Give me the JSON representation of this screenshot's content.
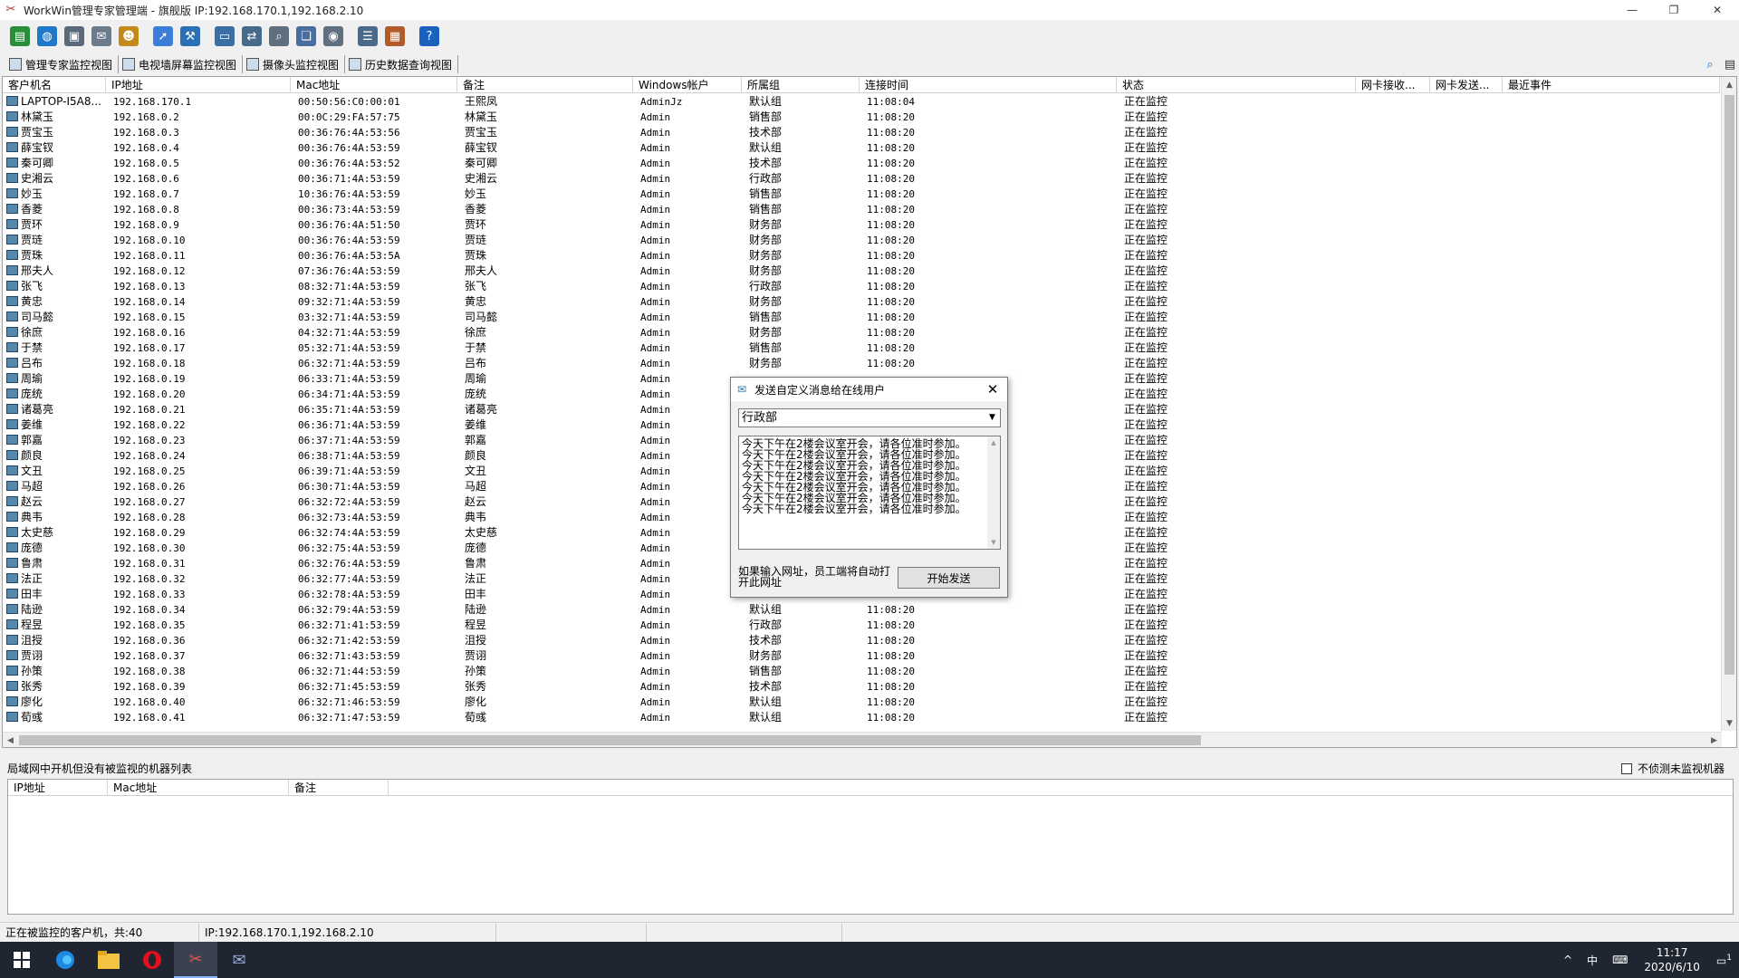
{
  "window": {
    "title": "WorkWin管理专家管理端 - 旗舰版 IP:192.168.170.1,192.168.2.10",
    "minimize": "—",
    "restore": "❐",
    "close": "✕"
  },
  "toolbar": {
    "buttons": [
      {
        "icon": "database-icon",
        "glyph": "▤",
        "color": "#2a8f3a"
      },
      {
        "icon": "globe-icon",
        "glyph": "◍",
        "color": "#1f78c8"
      },
      {
        "icon": "monitor-settings-icon",
        "glyph": "▣",
        "color": "#5a6a7a"
      },
      {
        "icon": "mail-icon",
        "glyph": "✉",
        "color": "#6b7b8c"
      },
      {
        "icon": "users-icon",
        "glyph": "☻",
        "color": "#c28a1a"
      },
      {
        "icon": "sep"
      },
      {
        "icon": "folder-send-icon",
        "glyph": "➚",
        "color": "#3b7dd8"
      },
      {
        "icon": "tools-icon",
        "glyph": "⚒",
        "color": "#2b70b5"
      },
      {
        "icon": "sep"
      },
      {
        "icon": "screen-icon",
        "glyph": "▭",
        "color": "#3a6ea5"
      },
      {
        "icon": "network-icon",
        "glyph": "⇄",
        "color": "#486a8a"
      },
      {
        "icon": "search-file-icon",
        "glyph": "⌕",
        "color": "#5f6f80"
      },
      {
        "icon": "windows-icon",
        "glyph": "❏",
        "color": "#4a6f9f"
      },
      {
        "icon": "camera-icon",
        "glyph": "◉",
        "color": "#607080"
      },
      {
        "icon": "sep"
      },
      {
        "icon": "list-icon",
        "glyph": "☰",
        "color": "#4b6a8b"
      },
      {
        "icon": "report-icon",
        "glyph": "▦",
        "color": "#b35a2a"
      },
      {
        "icon": "sep"
      },
      {
        "icon": "help-icon",
        "glyph": "?",
        "color": "#1b62c0"
      }
    ]
  },
  "tabs": [
    {
      "label": "管理专家监控视图",
      "icon": "monitor-view-icon"
    },
    {
      "label": "电视墙屏幕监控视图",
      "icon": "tv-wall-icon"
    },
    {
      "label": "摄像头监控视图",
      "icon": "camera-view-icon"
    },
    {
      "label": "历史数据查询视图",
      "icon": "history-icon"
    }
  ],
  "grid": {
    "columns": [
      "客户机名",
      "IP地址",
      "Mac地址",
      "备注",
      "Windows帐户",
      "所属组",
      "连接时间",
      "状态",
      "网卡接收...",
      "网卡发送...",
      "最近事件"
    ],
    "rows": [
      [
        "LAPTOP-I5A8...",
        "192.168.170.1",
        "00:50:56:C0:00:01",
        "王熙凤",
        "AdminJz",
        "默认组",
        "11:08:04",
        "正在监控"
      ],
      [
        "林黛玉",
        "192.168.0.2",
        "00:0C:29:FA:57:75",
        "林黛玉",
        "Admin",
        "销售部",
        "11:08:20",
        "正在监控"
      ],
      [
        "贾宝玉",
        "192.168.0.3",
        "00:36:76:4A:53:56",
        "贾宝玉",
        "Admin",
        "技术部",
        "11:08:20",
        "正在监控"
      ],
      [
        "薛宝钗",
        "192.168.0.4",
        "00:36:76:4A:53:59",
        "薛宝钗",
        "Admin",
        "默认组",
        "11:08:20",
        "正在监控"
      ],
      [
        "秦可卿",
        "192.168.0.5",
        "00:36:76:4A:53:52",
        "秦可卿",
        "Admin",
        "技术部",
        "11:08:20",
        "正在监控"
      ],
      [
        "史湘云",
        "192.168.0.6",
        "00:36:71:4A:53:59",
        "史湘云",
        "Admin",
        "行政部",
        "11:08:20",
        "正在监控"
      ],
      [
        "妙玉",
        "192.168.0.7",
        "10:36:76:4A:53:59",
        "妙玉",
        "Admin",
        "销售部",
        "11:08:20",
        "正在监控"
      ],
      [
        "香菱",
        "192.168.0.8",
        "00:36:73:4A:53:59",
        "香菱",
        "Admin",
        "销售部",
        "11:08:20",
        "正在监控"
      ],
      [
        "贾环",
        "192.168.0.9",
        "00:36:76:4A:51:50",
        "贾环",
        "Admin",
        "财务部",
        "11:08:20",
        "正在监控"
      ],
      [
        "贾琏",
        "192.168.0.10",
        "00:36:76:4A:53:59",
        "贾琏",
        "Admin",
        "财务部",
        "11:08:20",
        "正在监控"
      ],
      [
        "贾珠",
        "192.168.0.11",
        "00:36:76:4A:53:5A",
        "贾珠",
        "Admin",
        "财务部",
        "11:08:20",
        "正在监控"
      ],
      [
        "邢夫人",
        "192.168.0.12",
        "07:36:76:4A:53:59",
        "邢夫人",
        "Admin",
        "财务部",
        "11:08:20",
        "正在监控"
      ],
      [
        "张飞",
        "192.168.0.13",
        "08:32:71:4A:53:59",
        "张飞",
        "Admin",
        "行政部",
        "11:08:20",
        "正在监控"
      ],
      [
        "黄忠",
        "192.168.0.14",
        "09:32:71:4A:53:59",
        "黄忠",
        "Admin",
        "财务部",
        "11:08:20",
        "正在监控"
      ],
      [
        "司马懿",
        "192.168.0.15",
        "03:32:71:4A:53:59",
        "司马懿",
        "Admin",
        "销售部",
        "11:08:20",
        "正在监控"
      ],
      [
        "徐庶",
        "192.168.0.16",
        "04:32:71:4A:53:59",
        "徐庶",
        "Admin",
        "财务部",
        "11:08:20",
        "正在监控"
      ],
      [
        "于禁",
        "192.168.0.17",
        "05:32:71:4A:53:59",
        "于禁",
        "Admin",
        "销售部",
        "11:08:20",
        "正在监控"
      ],
      [
        "吕布",
        "192.168.0.18",
        "06:32:71:4A:53:59",
        "吕布",
        "Admin",
        "财务部",
        "11:08:20",
        "正在监控"
      ],
      [
        "周瑜",
        "192.168.0.19",
        "06:33:71:4A:53:59",
        "周瑜",
        "Admin",
        "",
        "",
        "正在监控"
      ],
      [
        "庞统",
        "192.168.0.20",
        "06:34:71:4A:53:59",
        "庞统",
        "Admin",
        "",
        "",
        "正在监控"
      ],
      [
        "诸葛亮",
        "192.168.0.21",
        "06:35:71:4A:53:59",
        "诸葛亮",
        "Admin",
        "",
        "",
        "正在监控"
      ],
      [
        "姜维",
        "192.168.0.22",
        "06:36:71:4A:53:59",
        "姜维",
        "Admin",
        "",
        "",
        "正在监控"
      ],
      [
        "郭嘉",
        "192.168.0.23",
        "06:37:71:4A:53:59",
        "郭嘉",
        "Admin",
        "",
        "",
        "正在监控"
      ],
      [
        "颜良",
        "192.168.0.24",
        "06:38:71:4A:53:59",
        "颜良",
        "Admin",
        "",
        "",
        "正在监控"
      ],
      [
        "文丑",
        "192.168.0.25",
        "06:39:71:4A:53:59",
        "文丑",
        "Admin",
        "",
        "",
        "正在监控"
      ],
      [
        "马超",
        "192.168.0.26",
        "06:30:71:4A:53:59",
        "马超",
        "Admin",
        "",
        "",
        "正在监控"
      ],
      [
        "赵云",
        "192.168.0.27",
        "06:32:72:4A:53:59",
        "赵云",
        "Admin",
        "",
        "",
        "正在监控"
      ],
      [
        "典韦",
        "192.168.0.28",
        "06:32:73:4A:53:59",
        "典韦",
        "Admin",
        "",
        "",
        "正在监控"
      ],
      [
        "太史慈",
        "192.168.0.29",
        "06:32:74:4A:53:59",
        "太史慈",
        "Admin",
        "",
        "",
        "正在监控"
      ],
      [
        "庞德",
        "192.168.0.30",
        "06:32:75:4A:53:59",
        "庞德",
        "Admin",
        "",
        "",
        "正在监控"
      ],
      [
        "鲁肃",
        "192.168.0.31",
        "06:32:76:4A:53:59",
        "鲁肃",
        "Admin",
        "",
        "",
        "正在监控"
      ],
      [
        "法正",
        "192.168.0.32",
        "06:32:77:4A:53:59",
        "法正",
        "Admin",
        "",
        "",
        "正在监控"
      ],
      [
        "田丰",
        "192.168.0.33",
        "06:32:78:4A:53:59",
        "田丰",
        "Admin",
        "",
        "",
        "正在监控"
      ],
      [
        "陆逊",
        "192.168.0.34",
        "06:32:79:4A:53:59",
        "陆逊",
        "Admin",
        "默认组",
        "11:08:20",
        "正在监控"
      ],
      [
        "程昱",
        "192.168.0.35",
        "06:32:71:41:53:59",
        "程昱",
        "Admin",
        "行政部",
        "11:08:20",
        "正在监控"
      ],
      [
        "沮授",
        "192.168.0.36",
        "06:32:71:42:53:59",
        "沮授",
        "Admin",
        "技术部",
        "11:08:20",
        "正在监控"
      ],
      [
        "贾诩",
        "192.168.0.37",
        "06:32:71:43:53:59",
        "贾诩",
        "Admin",
        "财务部",
        "11:08:20",
        "正在监控"
      ],
      [
        "孙策",
        "192.168.0.38",
        "06:32:71:44:53:59",
        "孙策",
        "Admin",
        "销售部",
        "11:08:20",
        "正在监控"
      ],
      [
        "张秀",
        "192.168.0.39",
        "06:32:71:45:53:59",
        "张秀",
        "Admin",
        "技术部",
        "11:08:20",
        "正在监控"
      ],
      [
        "廖化",
        "192.168.0.40",
        "06:32:71:46:53:59",
        "廖化",
        "Admin",
        "默认组",
        "11:08:20",
        "正在监控"
      ],
      [
        "荀彧",
        "192.168.0.41",
        "06:32:71:47:53:59",
        "荀彧",
        "Admin",
        "默认组",
        "11:08:20",
        "正在监控"
      ]
    ]
  },
  "lower": {
    "title": "局域网中开机但没有被监视的机器列表",
    "checkbox_label": "不侦测未监视机器",
    "columns": [
      "IP地址",
      "Mac地址",
      "备注"
    ]
  },
  "status": {
    "monitored": "正在被监控的客户机，共:40",
    "ip": "IP:192.168.170.1,192.168.2.10"
  },
  "dialog": {
    "title": "发送自定义消息给在线用户",
    "group": "行政部",
    "message_lines": [
      "今天下午在2楼会议室开会，请各位准时参加。",
      "今天下午在2楼会议室开会，请各位准时参加。",
      "今天下午在2楼会议室开会，请各位准时参加。",
      "今天下午在2楼会议室开会，请各位准时参加。",
      "今天下午在2楼会议室开会，请各位准时参加。",
      "今天下午在2楼会议室开会，请各位准时参加。",
      "今天下午在2楼会议室开会，请各位准时参加。"
    ],
    "note": "如果输入网址，员工端将自动打开此网址",
    "send_button": "开始发送"
  },
  "taskbar": {
    "tray_chevron": "^",
    "ime": "中",
    "keyboard": "⌨",
    "time": "11:17",
    "date": "2020/6/10",
    "notification_count": "1"
  }
}
